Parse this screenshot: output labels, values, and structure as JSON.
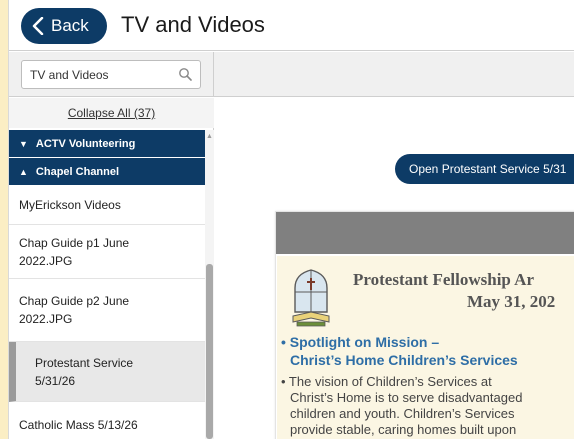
{
  "header": {
    "back_label": "Back",
    "title": "TV and Videos"
  },
  "search": {
    "value": "TV and Videos",
    "placeholder": "TV and Videos"
  },
  "sidebar": {
    "collapse_label": "Collapse All (37)",
    "groups": [
      {
        "label": "ACTV Volunteering",
        "state": "collapsed"
      },
      {
        "label": "Chapel Channel",
        "state": "expanded"
      }
    ],
    "items": [
      {
        "line1": "MyErickson Videos",
        "line2": ""
      },
      {
        "line1": "Chap Guide p1 June",
        "line2": "2022.JPG"
      },
      {
        "line1": "Chap Guide p2 June",
        "line2": "2022.JPG"
      },
      {
        "line1": "Protestant Service",
        "line2": "5/31/26",
        "selected": true
      },
      {
        "line1": "Catholic Mass 5/13/26",
        "line2": ""
      }
    ]
  },
  "main": {
    "open_button_label": "Open Protestant Service 5/31",
    "document": {
      "title": "Protestant Fellowship Ar",
      "date": "May 31, 202",
      "heading_line1": "• Spotlight on Mission –",
      "heading_line2": "Christ’s Home Children’s Services",
      "para_line1": "• The vision of Children’s Services at",
      "para_line2": "Christ’s Home is to serve disadvantaged",
      "para_line3": "children and youth. Children’s Services",
      "para_line4": "provide stable, caring homes built upon"
    }
  },
  "colors": {
    "brand_navy": "#0d3b66",
    "background": "#fbeec4",
    "doc_heading": "#2e6ea6"
  },
  "icons": {
    "back": "chevron-left-icon",
    "search": "search-icon",
    "group_collapsed": "caret-down-icon",
    "group_expanded": "caret-up-icon",
    "doc": "chapel-window-icon"
  }
}
